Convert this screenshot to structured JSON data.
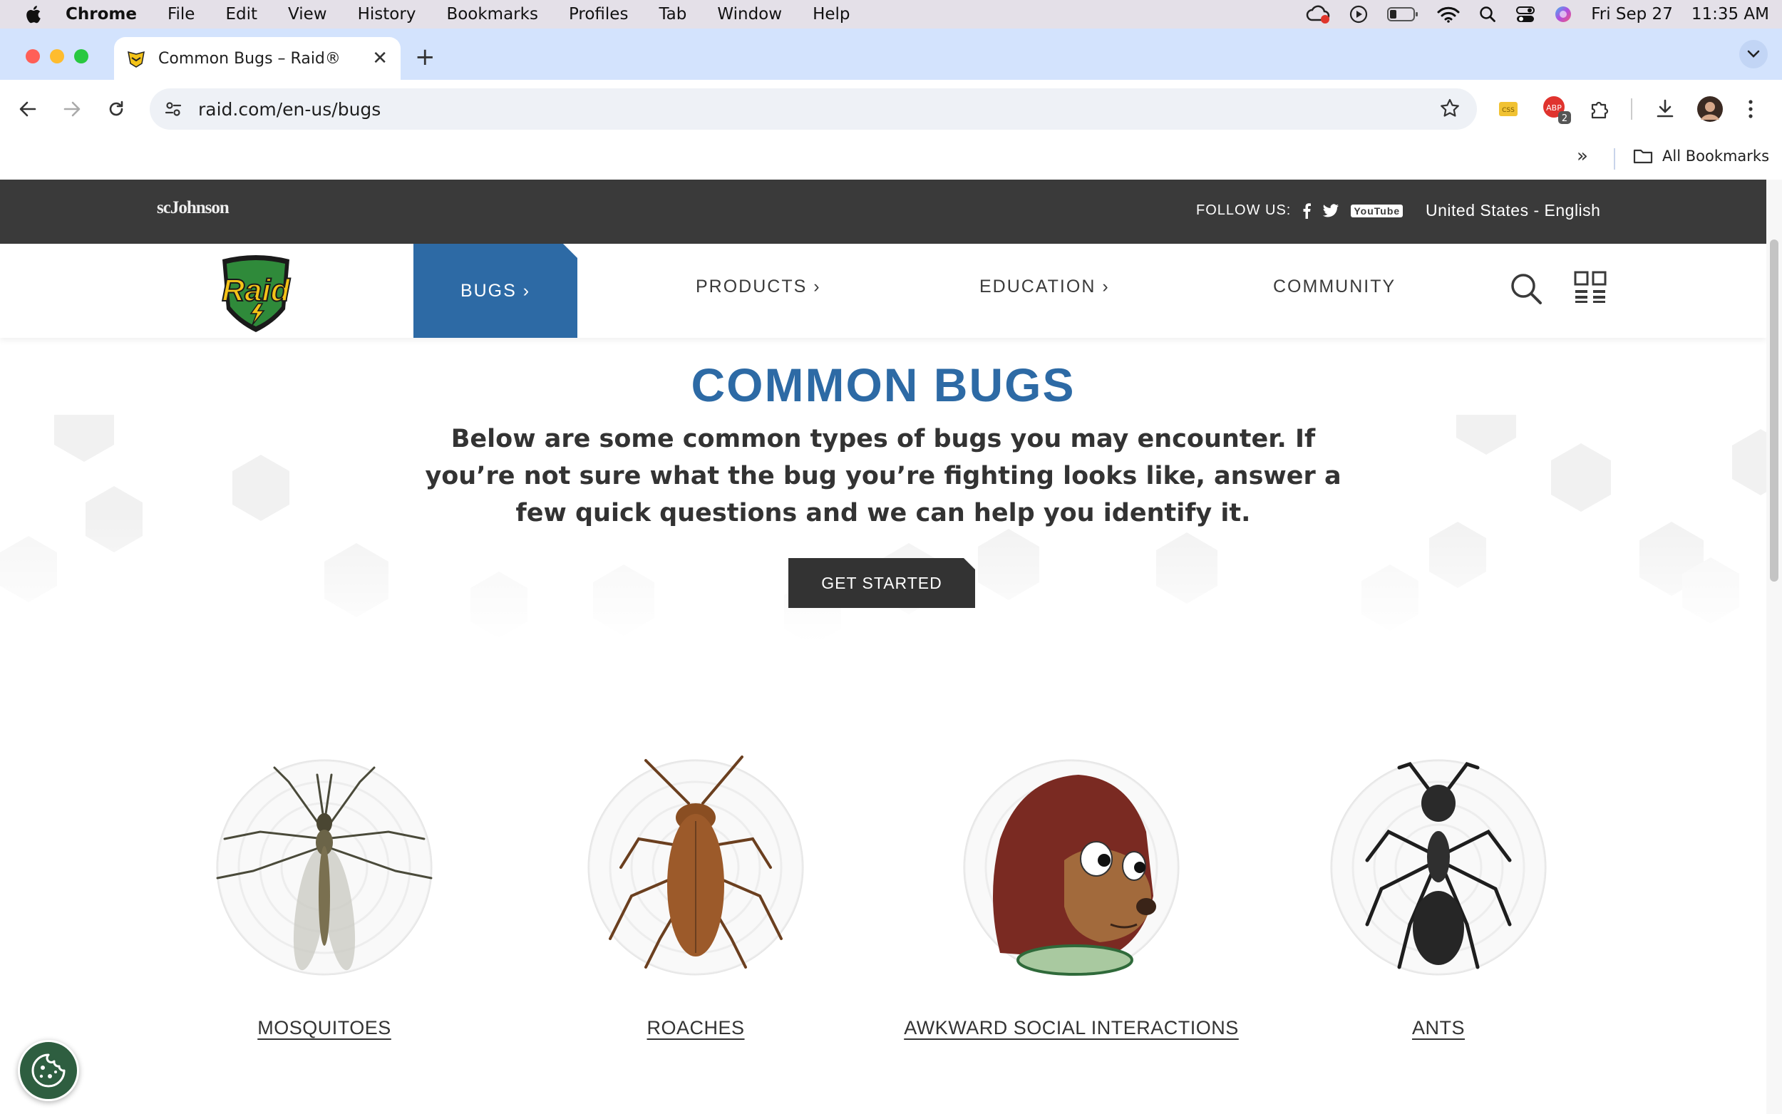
{
  "menubar": {
    "app": "Chrome",
    "items": [
      "File",
      "Edit",
      "View",
      "History",
      "Bookmarks",
      "Profiles",
      "Tab",
      "Window",
      "Help"
    ],
    "date": "Fri Sep 27",
    "time": "11:35 AM"
  },
  "browser": {
    "tab_title": "Common Bugs – Raid®",
    "url": "raid.com/en-us/bugs",
    "extension_badge": "2",
    "bookmarks_label": "All Bookmarks"
  },
  "site": {
    "brand": "scJohnson",
    "logo_text": "Raid",
    "follow_label": "FOLLOW US:",
    "youtube_text": "YouTube",
    "locale": "United States - English",
    "nav": {
      "bugs": "BUGS ›",
      "products": "PRODUCTS ›",
      "education": "EDUCATION ›",
      "community": "COMMUNITY"
    },
    "headline": "COMMON BUGS",
    "intro": "Below are some common types of bugs you may encounter. If you’re not sure what the bug you’re fighting looks like, answer a few quick questions and we can help you identify it.",
    "cta": "GET STARTED",
    "cards": [
      {
        "label": "MOSQUITOES",
        "icon": "mosquito-icon"
      },
      {
        "label": "ROACHES",
        "icon": "roach-icon"
      },
      {
        "label": "AWKWARD SOCIAL INTERACTIONS",
        "icon": "awkward-monkey-icon"
      },
      {
        "label": "ANTS",
        "icon": "ant-icon"
      }
    ]
  },
  "colors": {
    "brand_blue": "#2d6aa5",
    "topbar": "#3a3a3a",
    "tabstrip": "#d3e3fd",
    "cookie_button": "#2e5e40"
  }
}
